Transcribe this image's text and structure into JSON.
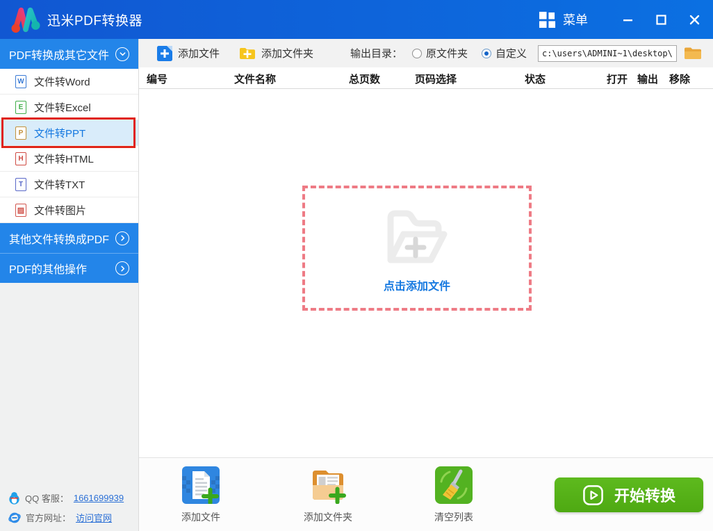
{
  "window": {
    "title": "迅米PDF转换器",
    "menu_label": "菜单"
  },
  "sidebar": {
    "sections": [
      {
        "label": "PDF转换成其它文件",
        "state": "expanded"
      },
      {
        "label": "其他文件转换成PDF",
        "state": "collapsed"
      },
      {
        "label": "PDF的其他操作",
        "state": "collapsed"
      }
    ],
    "items": [
      {
        "label": "文件转Word",
        "letter": "W",
        "selected": false
      },
      {
        "label": "文件转Excel",
        "letter": "E",
        "selected": false
      },
      {
        "label": "文件转PPT",
        "letter": "P",
        "selected": true
      },
      {
        "label": "文件转HTML",
        "letter": "H",
        "selected": false
      },
      {
        "label": "文件转TXT",
        "letter": "T",
        "selected": false
      },
      {
        "label": "文件转图片",
        "letter": "▨",
        "selected": false
      }
    ],
    "support": {
      "qq_label": "QQ 客服：",
      "qq_link": "1661699939",
      "site_label": "官方网址：",
      "site_link": "访问官网"
    }
  },
  "toolbar": {
    "add_file_label": "添加文件",
    "add_folder_label": "添加文件夹",
    "output_dir_label": "输出目录：",
    "radio_original": "原文件夹",
    "radio_custom": "自定义",
    "radio_selected": "自定义",
    "output_path": "c:\\users\\ADMINI~1\\desktop\\"
  },
  "table": {
    "headers": [
      "编号",
      "文件名称",
      "总页数",
      "页码选择",
      "状态",
      "打开",
      "输出",
      "移除"
    ]
  },
  "dropzone": {
    "label": "点击添加文件"
  },
  "bottombar": {
    "actions": [
      {
        "label": "添加文件"
      },
      {
        "label": "添加文件夹"
      },
      {
        "label": "清空列表"
      }
    ],
    "start_label": "开始转换"
  },
  "colors": {
    "titlebar_blue": "#0f63d8",
    "section_blue": "#2385e9",
    "accent_blue": "#1a7ce8",
    "selected_item_bg": "#d9ecfa",
    "highlight_red": "#e02418",
    "dropzone_pink": "#ee7b85",
    "start_green": "#55b317",
    "link_blue": "#2a6fd6",
    "folder_yellow": "#f6c51d"
  }
}
